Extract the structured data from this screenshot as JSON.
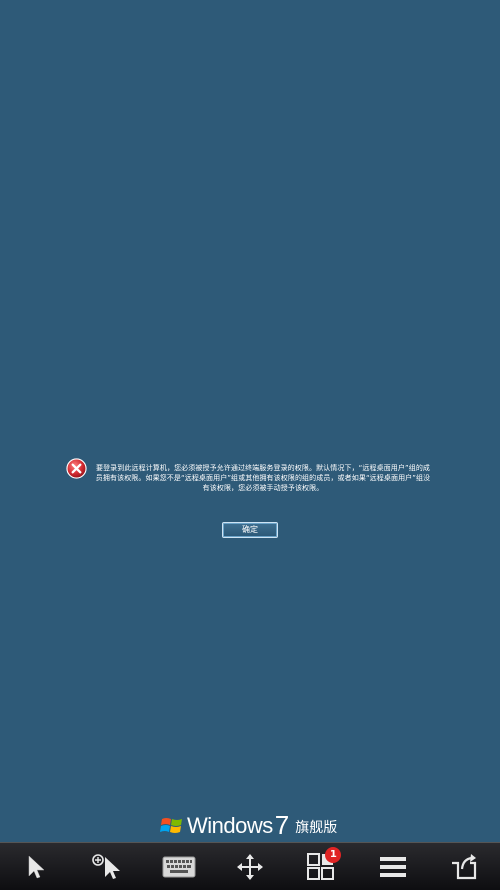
{
  "dialog": {
    "message": "要登录到此远程计算机，您必须被授予允许通过终端服务登录的权限。默认情况下，“远程桌面用户”组的成员拥有该权限。如果您不是“远程桌面用户”组或其他拥有该权限的组的成员，或者如果“远程桌面用户”组没有该权限，您必须被手动授予该权限。",
    "ok_label": "确定"
  },
  "brand": {
    "name": "Windows",
    "version": "7",
    "edition": "旗舰版"
  },
  "toolbar": {
    "items": [
      {
        "icon": "pointer-icon"
      },
      {
        "icon": "zoom-pointer-icon"
      },
      {
        "icon": "keyboard-icon"
      },
      {
        "icon": "move-icon"
      },
      {
        "icon": "apps-icon",
        "badge": "1"
      },
      {
        "icon": "menu-icon"
      },
      {
        "icon": "back-icon"
      }
    ]
  },
  "colors": {
    "background": "#2e5a78",
    "error_red": "#c8202a",
    "badge_red": "#e02424"
  }
}
